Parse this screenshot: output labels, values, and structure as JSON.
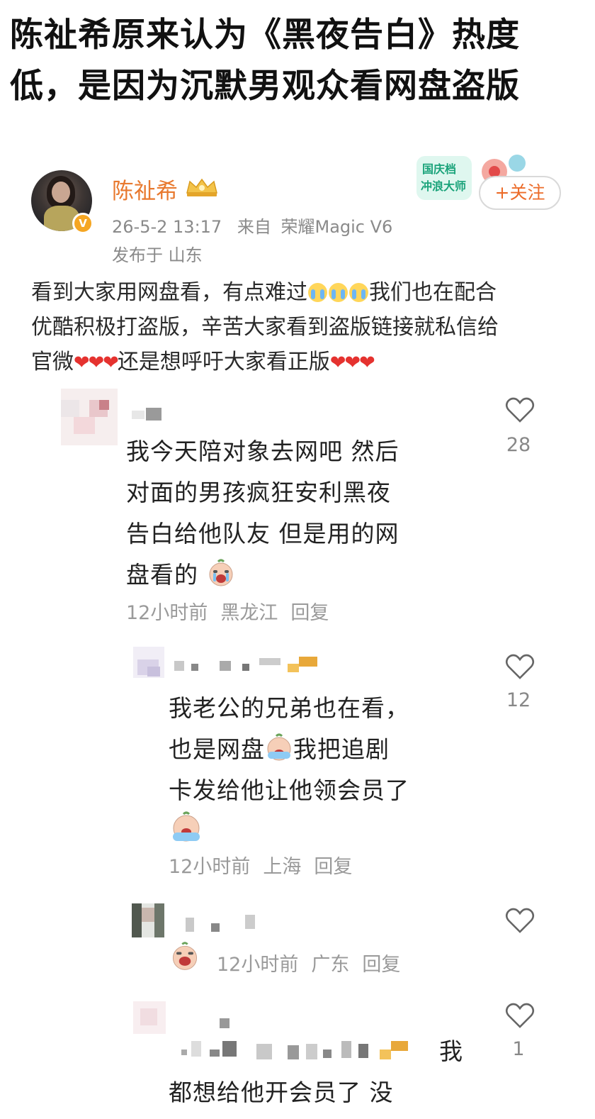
{
  "headline": {
    "line1": "陈祉希原来认为《黑夜告白》热度",
    "line2": "低，是因为沉默男观众看网盘盗版"
  },
  "post": {
    "username": "陈祉希",
    "verified_badge": "V",
    "timestamp": "26-5-2 13:17",
    "source_prefix": "来自",
    "source_device": "荣耀Magic V6",
    "location": "发布于 山东",
    "follow_label": "+关注",
    "sticker_text_1": "国庆档",
    "sticker_text_2": "冲浪大师",
    "text_line1_a": "看到大家用网盘看，有点难过",
    "text_line1_b": "我们也在配合",
    "text_line2": "优酷积极打盗版，辛苦大家看到盗版链接就私信给",
    "text_line3_a": "官微",
    "text_line3_b": "还是想呼吁大家看正版",
    "hearts": "❤❤❤"
  },
  "comments": [
    {
      "text_lines": [
        "我今天陪对象去网吧 然后",
        "对面的男孩疯狂安利黑夜",
        "告白给他队友 但是用的网",
        "盘看的"
      ],
      "time": "12小时前",
      "region": "黑龙江",
      "reply": "回复",
      "likes": "28"
    },
    {
      "text_lines": [
        "我老公的兄弟也在看，",
        "也是网盘",
        "我把追剧",
        "卡发给他让他领会员了"
      ],
      "time": "12小时前",
      "region": "上海",
      "reply": "回复",
      "likes": "12"
    },
    {
      "time": "12小时前",
      "region": "广东",
      "reply": "回复"
    },
    {
      "text_lines": [
        "我",
        "都想给他开会员了 没"
      ],
      "likes": "1"
    }
  ],
  "icons": {
    "like": "heart-outline-icon",
    "crown": "crown-icon",
    "crying": "crying-emoji-icon"
  },
  "colors": {
    "username": "#e8792f",
    "follow": "#ec6c2a",
    "heart": "#e5322f",
    "meta": "#8a8a8a"
  }
}
